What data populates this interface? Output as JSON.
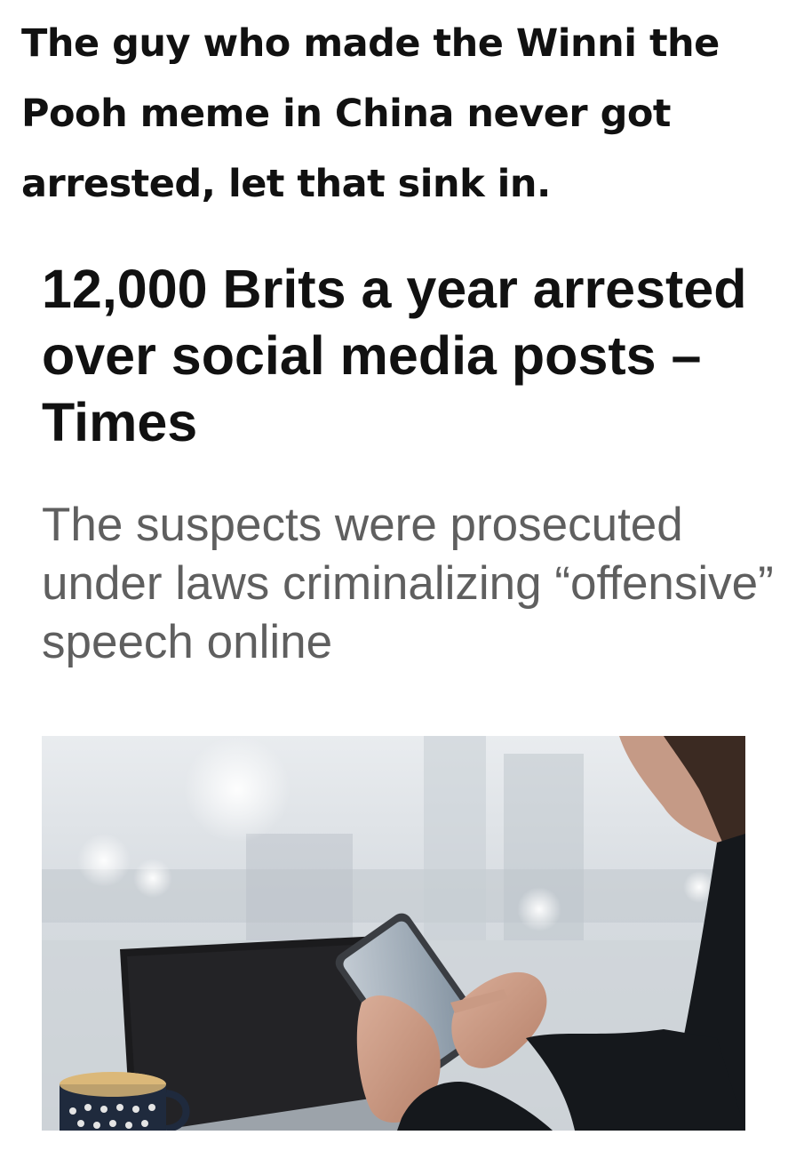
{
  "meme": {
    "caption": "The guy who made the Winni the Pooh meme in China never got arrested, let that sink in."
  },
  "article": {
    "headline": "12,000 Brits a year arrested over social media posts – Times",
    "subheadline": "The suspects were prosecuted under laws criminalizing “offensive” speech online"
  },
  "photo": {
    "subject": "person-using-smartphone-at-laptop",
    "colors": {
      "background": "#d8dde2",
      "laptop": "#1b1b1d",
      "sleeve": "#15181c",
      "skin": "#c99a84",
      "phone_screen": "#8fa0b0",
      "mug": "#1f2a3d"
    }
  }
}
